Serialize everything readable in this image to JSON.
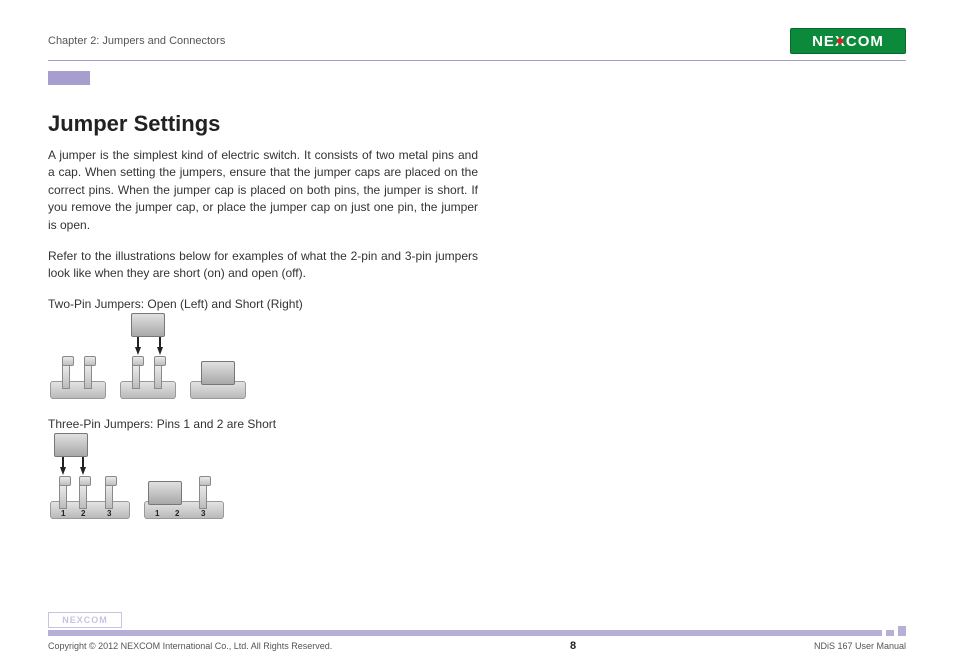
{
  "header": {
    "chapter": "Chapter 2: Jumpers and Connectors",
    "brand": "NEXCOM"
  },
  "main": {
    "title": "Jumper Settings",
    "para1": "A jumper is the simplest kind of electric switch. It consists of two metal pins and a cap. When setting the jumpers, ensure that the jumper caps are placed on the correct pins. When the jumper cap is placed on both pins, the jumper is short. If you remove the jumper cap, or place the jumper cap on just one pin, the jumper is open.",
    "para2": "Refer to the illustrations below for examples of what the 2-pin and 3-pin jumpers look like when they are short (on) and open (off).",
    "caption1": "Two-Pin Jumpers: Open (Left) and Short (Right)",
    "caption2": "Three-Pin Jumpers: Pins 1 and 2 are Short",
    "pin_labels": {
      "p1": "1",
      "p2": "2",
      "p3": "3"
    }
  },
  "footer": {
    "brand_small": "NEXCOM",
    "copyright": "Copyright © 2012 NEXCOM International Co., Ltd. All Rights Reserved.",
    "page_number": "8",
    "doc_ref": "NDiS 167 User Manual"
  }
}
